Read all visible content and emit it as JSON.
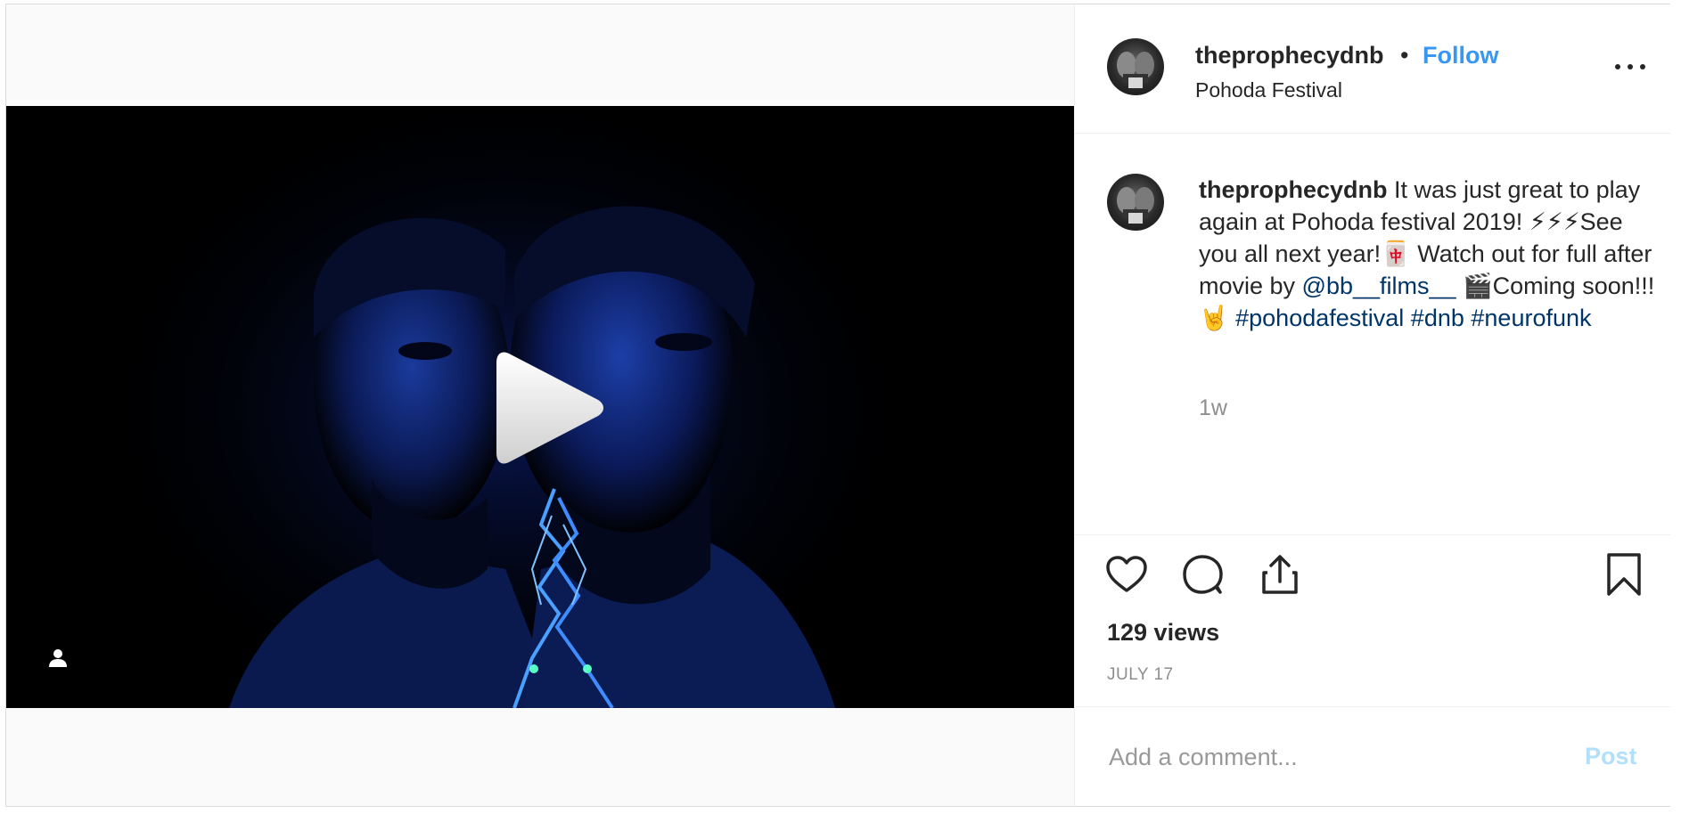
{
  "post": {
    "header": {
      "username": "theprophecydnb",
      "separator": "•",
      "follow_label": "Follow",
      "location": "Pohoda Festival",
      "more_icon": "more-horizontal-icon"
    },
    "caption": {
      "username": "theprophecydnb",
      "text_1": " It was just great to play again at Pohoda festival 2019! ⚡⚡⚡See you all next year!🀄 Watch out for full after movie by ",
      "mention": "@bb__films__",
      "text_2": " 🎬Coming soon!!!🤘 ",
      "hashtags": [
        "#pohodafestival",
        "#dnb",
        "#neurofunk"
      ],
      "time_ago": "1w"
    },
    "actions": {
      "like_icon": "heart-icon",
      "comment_icon": "comment-bubble-icon",
      "share_icon": "share-icon",
      "save_icon": "bookmark-icon"
    },
    "views": "129 views",
    "date": "JULY 17",
    "comment": {
      "placeholder": "Add a comment...",
      "post_label": "Post"
    },
    "media": {
      "type": "video",
      "play_icon": "play-icon",
      "tag_icon": "user-tag-icon"
    },
    "colors": {
      "link_blue": "#3897f0",
      "hashtag_blue": "#003569",
      "post_disabled": "#b2dffc",
      "muted_gray": "#8e8e8e"
    }
  }
}
